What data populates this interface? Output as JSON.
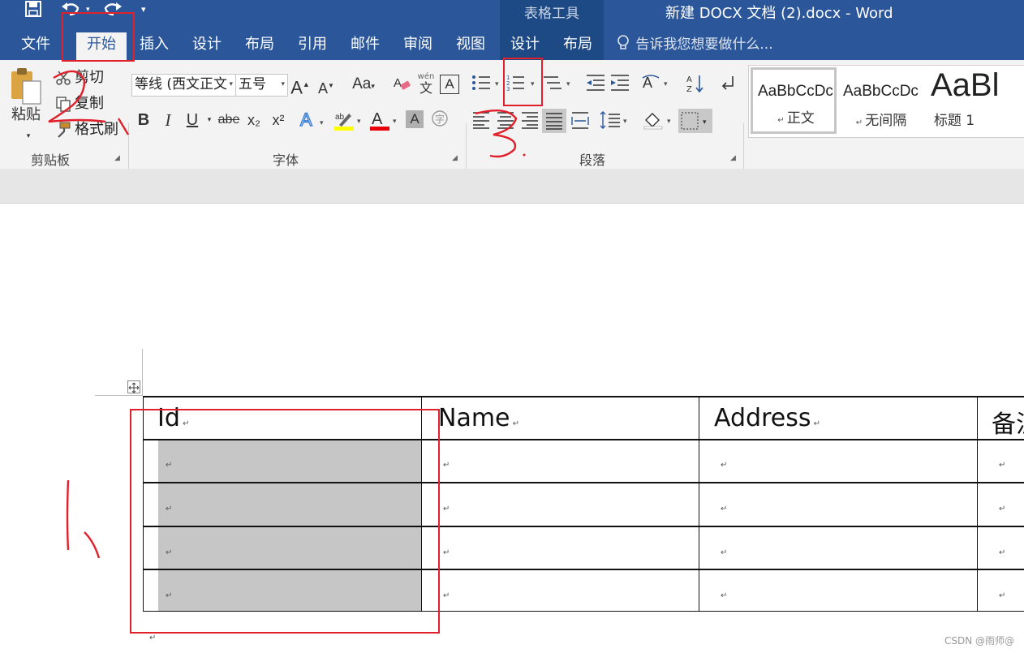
{
  "window": {
    "title": "新建 DOCX 文档 (2).docx - Word",
    "context_group": "表格工具",
    "quick_access": [
      "save-icon",
      "undo-icon",
      "redo-icon",
      "customize-icon"
    ]
  },
  "tabs": [
    "文件",
    "开始",
    "插入",
    "设计",
    "布局",
    "引用",
    "邮件",
    "审阅",
    "视图",
    "设计",
    "布局"
  ],
  "active_tab": "开始",
  "tell_me": "告诉我您想要做什么...",
  "clipboard": {
    "group_label": "剪贴板",
    "paste": "粘贴",
    "cut": "剪切",
    "copy": "复制",
    "format_painter": "格式刷"
  },
  "font": {
    "group_label": "字体",
    "font_name": "等线 (西文正文",
    "font_size": "五号",
    "bold": "B",
    "italic": "I",
    "underline": "U",
    "strike": "abe",
    "subscript": "x₂",
    "superscript": "x²",
    "grow": "A",
    "shrink": "A",
    "change_case": "Aa",
    "phonetic": "wén",
    "phonetic_char": "文",
    "font_color_hex": "#e8000b",
    "highlight_hex": "#ffff00"
  },
  "paragraph": {
    "group_label": "段落"
  },
  "styles": [
    {
      "preview": "AaBbCcDc",
      "name": "正文"
    },
    {
      "preview": "AaBbCcDc",
      "name": "无间隔"
    },
    {
      "preview": "AaBl",
      "name": "标题 1"
    }
  ],
  "table": {
    "headers": [
      "Id",
      "Name",
      "Address",
      "备注"
    ],
    "rows": 4
  },
  "annotations": {
    "colors": {
      "red": "#e0202a"
    }
  },
  "watermark": "CSDN @雨师@"
}
